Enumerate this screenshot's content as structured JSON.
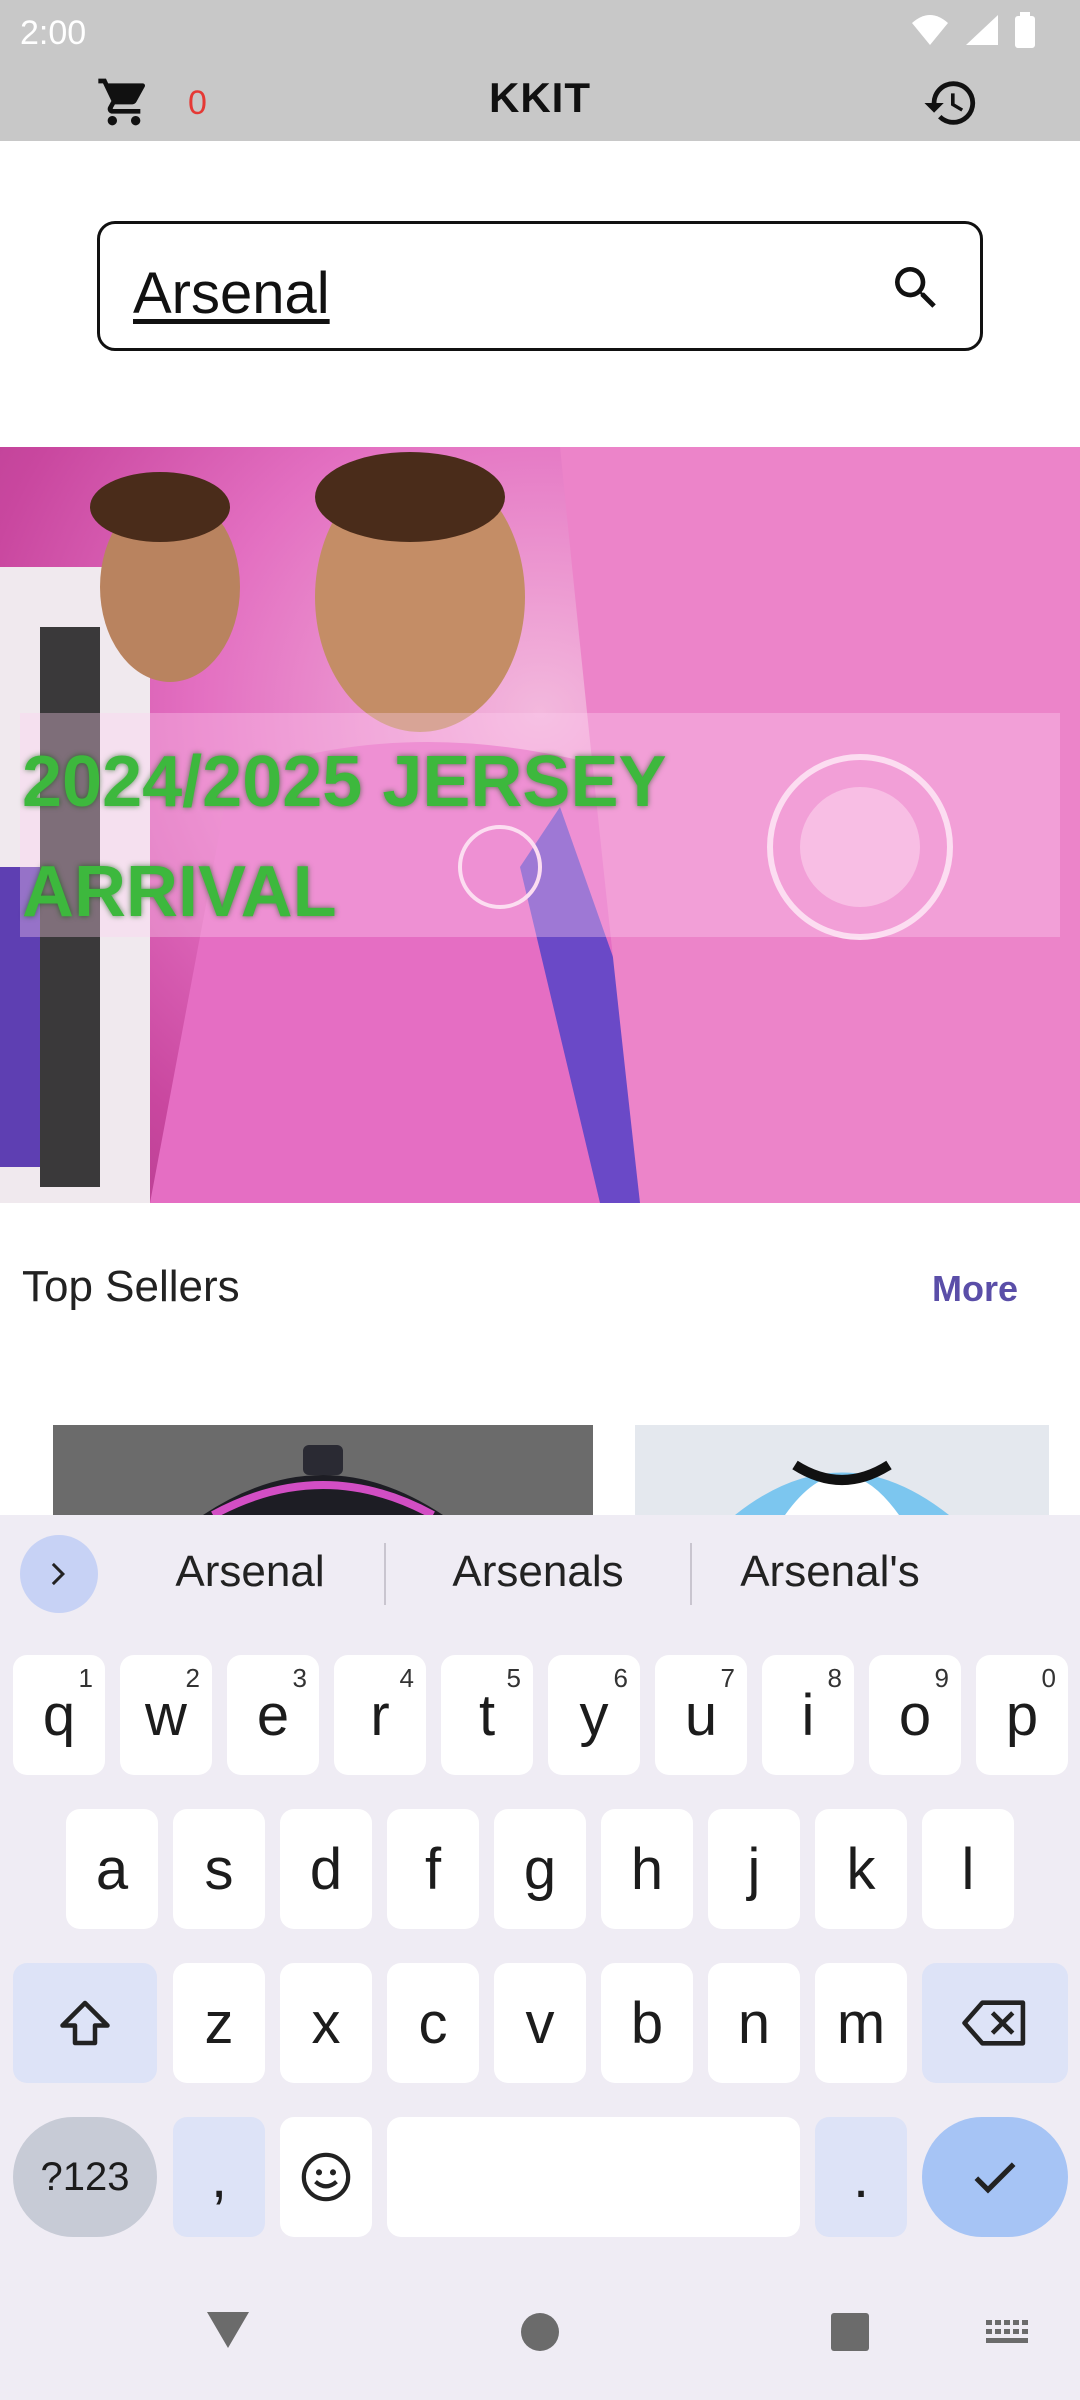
{
  "status": {
    "time": "2:00"
  },
  "app": {
    "title": "KKIT",
    "cart_count": "0"
  },
  "search": {
    "value": "Arsenal"
  },
  "banner": {
    "line1": "2024/2025 JERSEY",
    "line2": "ARRIVAL"
  },
  "sellers": {
    "title": "Top Sellers",
    "more": "More"
  },
  "keyboard": {
    "suggestions": [
      "Arsenal",
      "Arsenals",
      "Arsenal's"
    ],
    "row1": [
      {
        "k": "q",
        "h": "1"
      },
      {
        "k": "w",
        "h": "2"
      },
      {
        "k": "e",
        "h": "3"
      },
      {
        "k": "r",
        "h": "4"
      },
      {
        "k": "t",
        "h": "5"
      },
      {
        "k": "y",
        "h": "6"
      },
      {
        "k": "u",
        "h": "7"
      },
      {
        "k": "i",
        "h": "8"
      },
      {
        "k": "o",
        "h": "9"
      },
      {
        "k": "p",
        "h": "0"
      }
    ],
    "row2": [
      "a",
      "s",
      "d",
      "f",
      "g",
      "h",
      "j",
      "k",
      "l"
    ],
    "row3": [
      "z",
      "x",
      "c",
      "v",
      "b",
      "n",
      "m"
    ],
    "sym_label": "?123",
    "comma": ",",
    "period": "."
  },
  "colors": {
    "accent": "#5a4ea8",
    "cart_count": "#e53935",
    "banner_text": "#3db83d"
  },
  "icons": {
    "cart": "cart-icon",
    "history": "history-icon",
    "search": "search-icon",
    "expand": "chevron-right-icon",
    "shift": "shift-icon",
    "backspace": "backspace-icon",
    "emoji": "emoji-icon",
    "enter": "check-icon",
    "back": "nav-back-icon",
    "home": "nav-home-icon",
    "recents": "nav-recents-icon",
    "keyboard": "keyboard-icon"
  }
}
